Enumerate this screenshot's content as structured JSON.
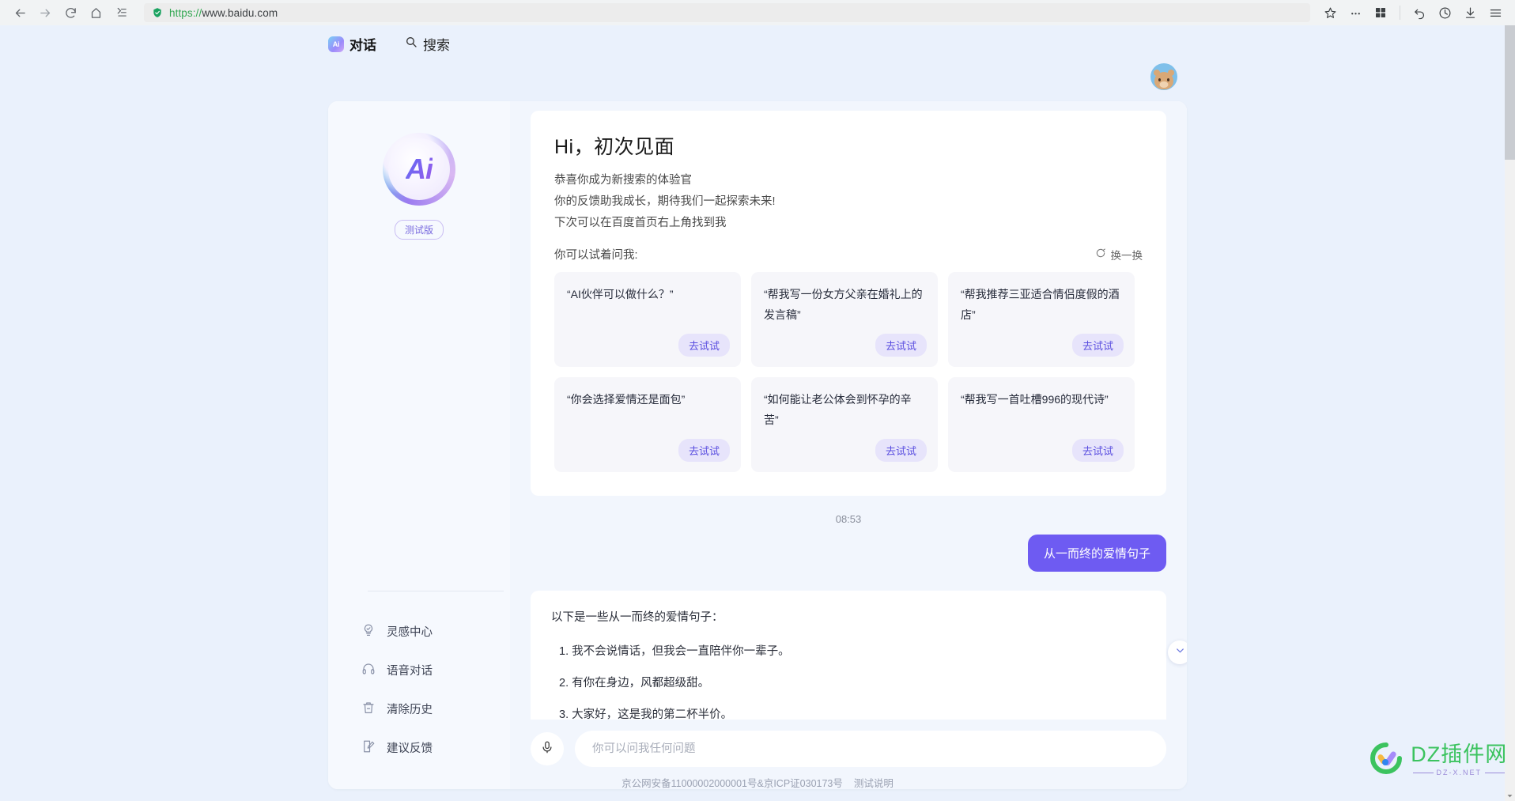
{
  "browser": {
    "url_scheme": "https://",
    "url_host": "www.baidu.com",
    "back_icon": "back-arrow-icon",
    "forward_icon": "forward-arrow-icon",
    "reload_icon": "reload-icon",
    "home_icon": "home-icon",
    "collections_icon": "collections-icon",
    "security_icon": "shield-secure-icon",
    "favorite_icon": "star-icon",
    "more_icon": "ellipsis-icon",
    "apps_icon": "grid-apps-icon",
    "undo_icon": "undo-icon",
    "history_icon": "clock-history-icon",
    "downloads_icon": "download-icon",
    "menu_icon": "hamburger-menu-icon"
  },
  "topnav": {
    "items": [
      {
        "label": "对话",
        "icon": "ai-badge-icon",
        "active": true
      },
      {
        "label": "搜索",
        "icon": "search-icon",
        "active": false
      }
    ],
    "avatar": "user-avatar"
  },
  "sidebar": {
    "logo_text": "Ai",
    "badge": "测试版",
    "items": [
      {
        "label": "灵感中心",
        "icon": "lightbulb-icon"
      },
      {
        "label": "语音对话",
        "icon": "headphones-icon"
      },
      {
        "label": "清除历史",
        "icon": "trash-icon"
      },
      {
        "label": "建议反馈",
        "icon": "feedback-edit-icon"
      }
    ]
  },
  "welcome": {
    "title": "Hi，初次见面",
    "lines": [
      "恭喜你成为新搜索的体验官",
      "你的反馈助我成长，期待我们一起探索未来!",
      "下次可以在百度首页右上角找到我"
    ],
    "try_label": "你可以试着问我:",
    "refresh_label": "换一换",
    "refresh_icon": "refresh-circle-icon",
    "cards": [
      {
        "question": "“AI伙伴可以做什么？”",
        "button": "去试试"
      },
      {
        "question": "“帮我写一份女方父亲在婚礼上的发言稿”",
        "button": "去试试"
      },
      {
        "question": "“帮我推荐三亚适合情侣度假的酒店”",
        "button": "去试试"
      },
      {
        "question": "“你会选择爱情还是面包”",
        "button": "去试试"
      },
      {
        "question": "“如何能让老公体会到怀孕的辛苦”",
        "button": "去试试"
      },
      {
        "question": "“帮我写一首吐槽996的现代诗”",
        "button": "去试试"
      }
    ]
  },
  "conversation": {
    "timestamp": "08:53",
    "user_message": "从一而终的爱情句子",
    "bot_intro": "以下是一些从一而终的爱情句子：",
    "bot_items": [
      "1. 我不会说情话，但我会一直陪伴你一辈子。",
      "2. 有你在身边，风都超级甜。",
      "3. 大家好，这是我的第二杯半价。"
    ],
    "scroll_down_icon": "chevron-down-icon"
  },
  "composer": {
    "mic_icon": "microphone-icon",
    "placeholder": "你可以问我任何问题",
    "value": ""
  },
  "footer": {
    "license": "京公网安备11000002000001号&京ICP证030173号",
    "note": "测试说明"
  },
  "watermark": {
    "main": "DZ插件网",
    "sub": "DZ-X.NET"
  },
  "colors": {
    "accent_purple": "#6e5bf2",
    "page_bg": "#eaf1fc",
    "card_bg": "#f6f6fa",
    "try_btn_bg": "#e7e4fb",
    "watermark_green": "#3cc35f"
  }
}
